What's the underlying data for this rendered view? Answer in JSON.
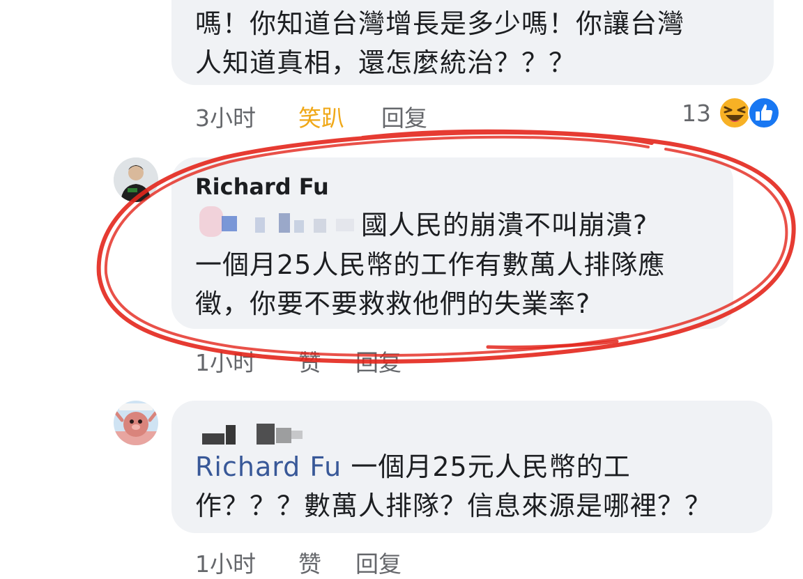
{
  "comment1": {
    "line1": "嗎！你知道台灣增長是多少嗎！你讓台灣",
    "line2": "人知道真相，還怎麼統治？？？",
    "time": "3小时",
    "reaction_label": "笑趴",
    "reply_label": "回复",
    "reaction_count": "13",
    "reaction_colors": {
      "laugh": "#f7b125",
      "like": "#1877f2",
      "selected": "#f0a818"
    }
  },
  "comment2": {
    "author": "Richard Fu",
    "line1_suffix": "國人民的崩潰不叫崩潰?",
    "line2": "一個月25人民幣的工作有數萬人排隊應",
    "line3": "徵，你要不要救救他們的失業率?",
    "time": "1小时",
    "like_label": "赞",
    "reply_label": "回复",
    "annotation_color": "#e3261c"
  },
  "comment3": {
    "mention": "Richard Fu",
    "line1_text": "一個月25元人民幣的工",
    "line2": "作？？？數萬人排隊？信息來源是哪裡？？",
    "time": "1小时",
    "like_label": "赞",
    "reply_label": "回复"
  }
}
